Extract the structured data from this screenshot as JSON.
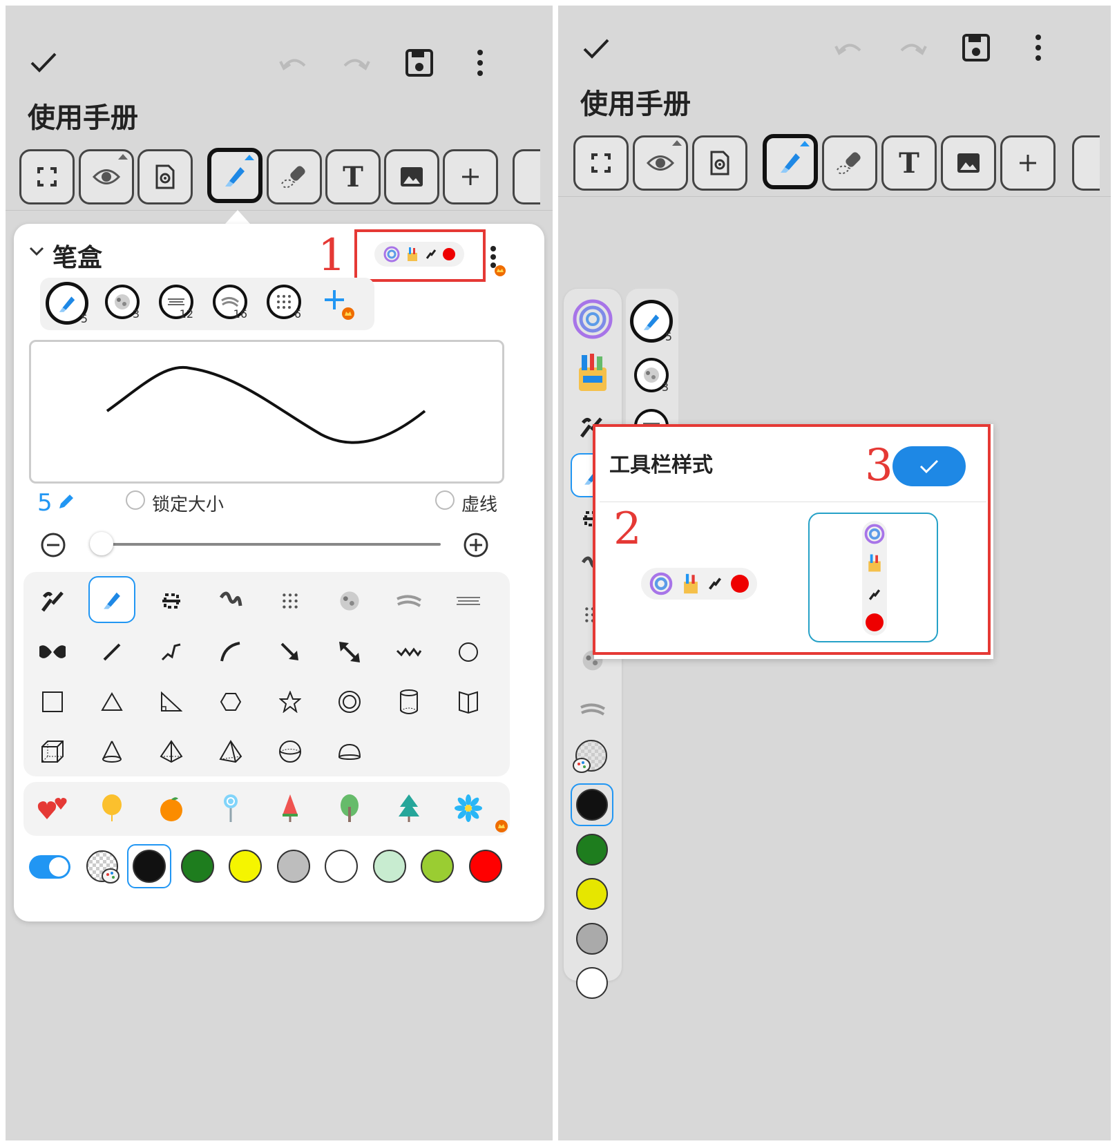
{
  "app": {
    "doc_title": "使用手册"
  },
  "toolbar": {
    "tools": [
      "fullscreen",
      "view",
      "settings",
      "pen",
      "eraser",
      "text",
      "image",
      "add"
    ]
  },
  "pen_box": {
    "title": "笔盒",
    "pens": [
      {
        "size": "5",
        "icon": "highlighter-icon"
      },
      {
        "size": "3",
        "icon": "crayon-icon"
      },
      {
        "size": "12",
        "icon": "brush-icon"
      },
      {
        "size": "16",
        "icon": "chalk-icon"
      },
      {
        "size": "6",
        "icon": "dots-icon"
      }
    ],
    "size_value": "5",
    "lock_size_label": "锁定大小",
    "dashed_label": "虚线"
  },
  "colors": [
    "#111111",
    "#1e7d1e",
    "#f5f500",
    "#bdbdbd",
    "#ffffff",
    "#c8ecd0",
    "#9acd32",
    "#ff0000"
  ],
  "right_colors": [
    "#111111",
    "#1e7d1e",
    "#e6e600",
    "#aaaaaa",
    "#ffffff"
  ],
  "toolbar_style_dialog": {
    "title": "工具栏样式",
    "toggle_on": true
  },
  "annotations": {
    "n1": "1",
    "n2": "2",
    "n3": "3"
  }
}
